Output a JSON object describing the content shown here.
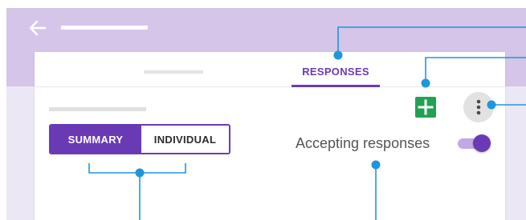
{
  "colors": {
    "header_band": "#d4c5e9",
    "lower_band": "#ece7f4",
    "accent": "#6a3ab5",
    "callout": "#1e96de",
    "sheets_green": "#22a152",
    "icon_dark": "#4a4a4a"
  },
  "header": {
    "back_icon": "arrow-left-icon"
  },
  "tabs": {
    "responses_label": "RESPONSES"
  },
  "toolbar": {
    "sheets_icon": "sheets-plus-icon",
    "more_icon": "more-vertical-icon"
  },
  "view_toggle": {
    "options": [
      "SUMMARY",
      "INDIVIDUAL"
    ],
    "selected": "SUMMARY"
  },
  "accepting": {
    "label": "Accepting responses",
    "enabled": true
  }
}
